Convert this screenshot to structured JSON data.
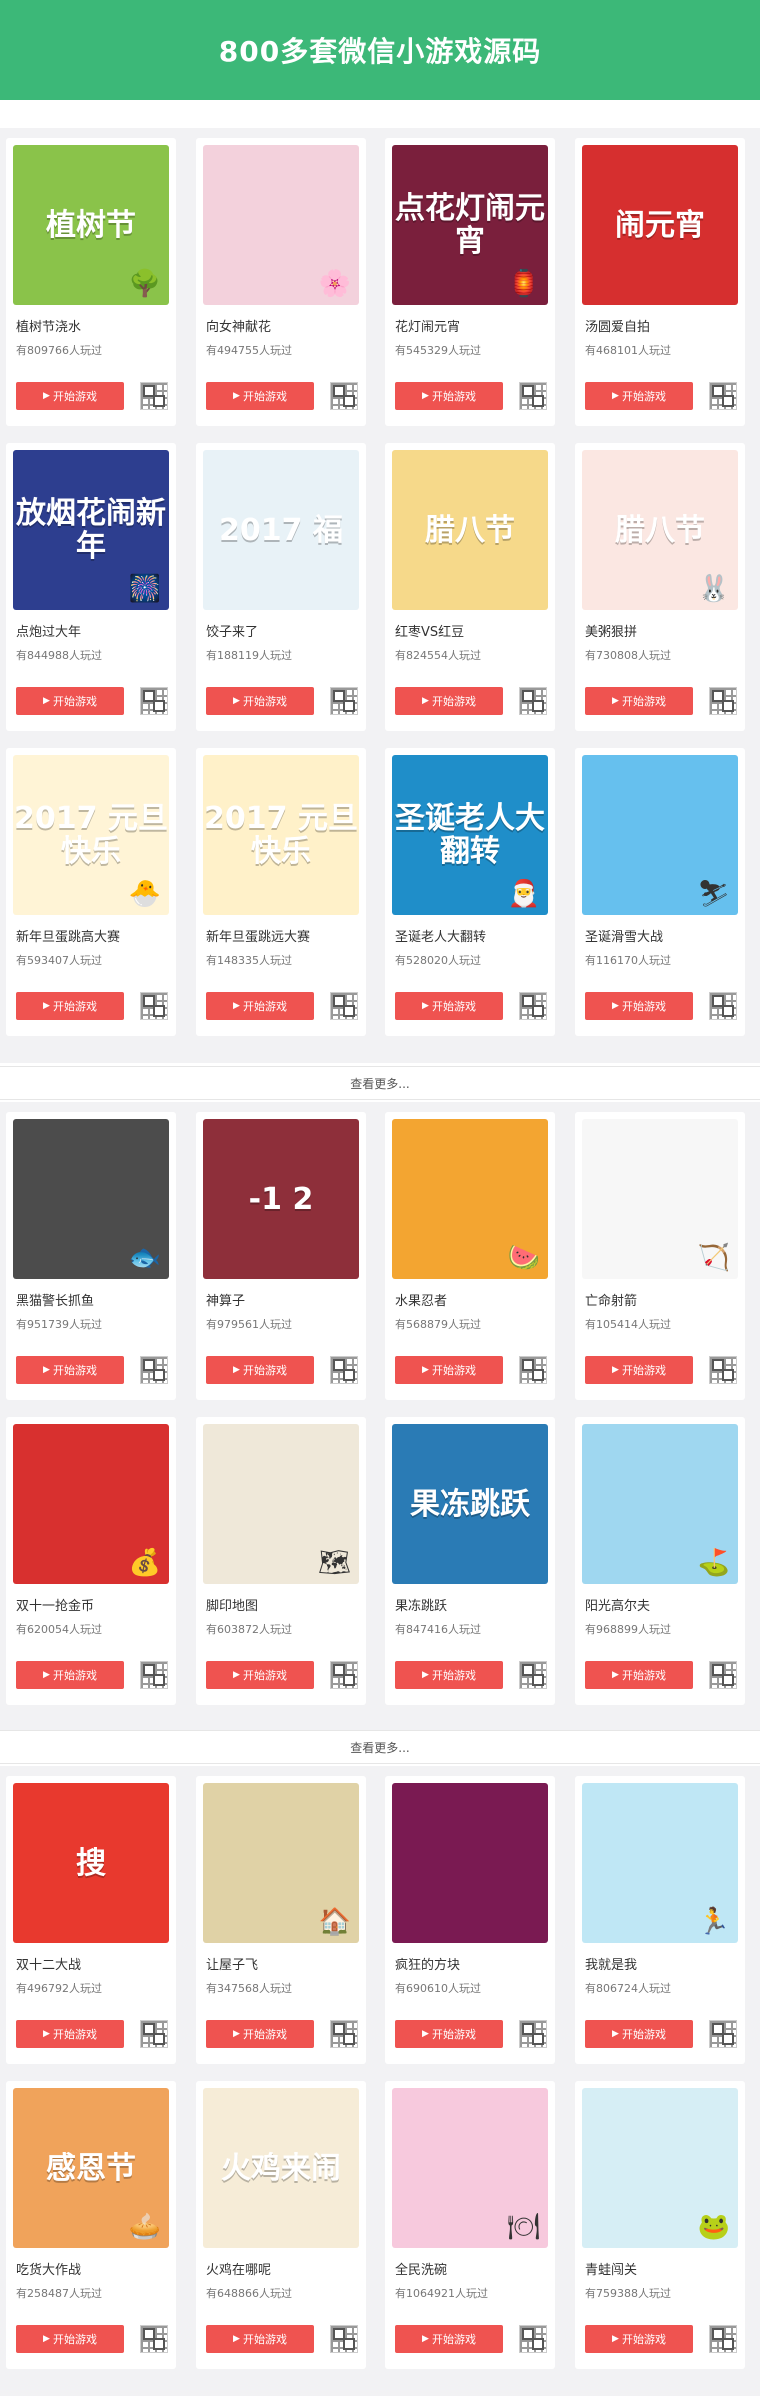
{
  "header": {
    "title": "800多套微信小游戏源码"
  },
  "labels": {
    "play": "开始游戏",
    "more": "查看更多..."
  },
  "sections": [
    {
      "games": [
        {
          "name": "植树节浇水",
          "plays": "有809766人玩过",
          "art": "植树节",
          "bg": "#8ac34a",
          "deco": "🌳"
        },
        {
          "name": "向女神献花",
          "plays": "有494755人玩过",
          "art": "",
          "bg": "#f3d1dc",
          "deco": "🌸"
        },
        {
          "name": "花灯闹元宵",
          "plays": "有545329人玩过",
          "art": "点花灯闹元宵",
          "bg": "#7a1f3c",
          "deco": "🏮"
        },
        {
          "name": "汤圆爱自拍",
          "plays": "有468101人玩过",
          "art": "闹元宵",
          "bg": "#d62f2f",
          "deco": ""
        },
        {
          "name": "点炮过大年",
          "plays": "有844988人玩过",
          "art": "放烟花闹新年",
          "bg": "#2d3e8f",
          "deco": "🎆"
        },
        {
          "name": "饺子来了",
          "plays": "有188119人玩过",
          "art": "2017 福",
          "bg": "#e8f2f7",
          "deco": ""
        },
        {
          "name": "红枣VS红豆",
          "plays": "有824554人玩过",
          "art": "腊八节",
          "bg": "#f6d98a",
          "deco": ""
        },
        {
          "name": "美粥狠拼",
          "plays": "有730808人玩过",
          "art": "腊八节",
          "bg": "#fbe7e2",
          "deco": "🐰"
        },
        {
          "name": "新年旦蛋跳高大赛",
          "plays": "有593407人玩过",
          "art": "2017 元旦快乐",
          "bg": "#fff4d6",
          "deco": "🐣"
        },
        {
          "name": "新年旦蛋跳远大赛",
          "plays": "有148335人玩过",
          "art": "2017 元旦快乐",
          "bg": "#fff1c9",
          "deco": ""
        },
        {
          "name": "圣诞老人大翻转",
          "plays": "有528020人玩过",
          "art": "圣诞老人大翻转",
          "bg": "#1f8ec9",
          "deco": "🎅"
        },
        {
          "name": "圣诞滑雪大战",
          "plays": "有116170人玩过",
          "art": "",
          "bg": "#66c0ee",
          "deco": "⛷"
        }
      ]
    },
    {
      "games": [
        {
          "name": "黑猫警长抓鱼",
          "plays": "有951739人玩过",
          "art": "",
          "bg": "#4c4c4c",
          "deco": "🐟"
        },
        {
          "name": "神算子",
          "plays": "有979561人玩过",
          "art": "-1  2",
          "bg": "#8e2f3a",
          "deco": ""
        },
        {
          "name": "水果忍者",
          "plays": "有568879人玩过",
          "art": "",
          "bg": "#f3a531",
          "deco": "🍉"
        },
        {
          "name": "亡命射箭",
          "plays": "有105414人玩过",
          "art": "",
          "bg": "#f7f7f7",
          "deco": "🏹"
        },
        {
          "name": "双十一抢金币",
          "plays": "有620054人玩过",
          "art": "",
          "bg": "#d8302f",
          "deco": "💰"
        },
        {
          "name": "脚印地图",
          "plays": "有603872人玩过",
          "art": "",
          "bg": "#efe8d9",
          "deco": "🗺"
        },
        {
          "name": "果冻跳跃",
          "plays": "有847416人玩过",
          "art": "果冻跳跃",
          "bg": "#2a7bb5",
          "deco": ""
        },
        {
          "name": "阳光高尔夫",
          "plays": "有968899人玩过",
          "art": "",
          "bg": "#9fd7f0",
          "deco": "⛳"
        }
      ]
    },
    {
      "games": [
        {
          "name": "双十二大战",
          "plays": "有496792人玩过",
          "art": "搜",
          "bg": "#e8392e",
          "deco": ""
        },
        {
          "name": "让屋子飞",
          "plays": "有347568人玩过",
          "art": "",
          "bg": "#e0d2a6",
          "deco": "🏠"
        },
        {
          "name": "疯狂的方块",
          "plays": "有690610人玩过",
          "art": "",
          "bg": "#7a1a52",
          "deco": ""
        },
        {
          "name": "我就是我",
          "plays": "有806724人玩过",
          "art": "",
          "bg": "#bfe7f5",
          "deco": "🏃"
        },
        {
          "name": "吃货大作战",
          "plays": "有258487人玩过",
          "art": "感恩节",
          "bg": "#f0a35b",
          "deco": "🥧"
        },
        {
          "name": "火鸡在哪呢",
          "plays": "有648866人玩过",
          "art": "火鸡来闹",
          "bg": "#f6ecd7",
          "deco": ""
        },
        {
          "name": "全民洗碗",
          "plays": "有1064921人玩过",
          "art": "",
          "bg": "#f7c9dd",
          "deco": "🍽"
        },
        {
          "name": "青蛙闯关",
          "plays": "有759388人玩过",
          "art": "",
          "bg": "#d6eef5",
          "deco": "🐸"
        }
      ]
    }
  ],
  "colors": {
    "header": "#3cb878",
    "button": "#ef5350",
    "bg": "#f2f2f4"
  }
}
